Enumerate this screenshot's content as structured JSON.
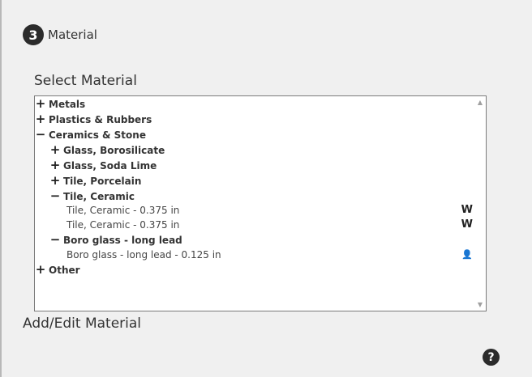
{
  "step": {
    "number": "3",
    "title": "Material"
  },
  "select_label": "Select Material",
  "add_edit_label": "Add/Edit Material",
  "scroll": {
    "up": "▲",
    "down": "▼"
  },
  "help": {
    "glyph": "?"
  },
  "tree": [
    {
      "symbol": "+",
      "label": "Metals"
    },
    {
      "symbol": "+",
      "label": "Plastics & Rubbers"
    },
    {
      "symbol": "−",
      "label": "Ceramics & Stone"
    },
    {
      "symbol": "+",
      "label": "Glass, Borosilicate"
    },
    {
      "symbol": "+",
      "label": "Glass, Soda Lime"
    },
    {
      "symbol": "+",
      "label": "Tile, Porcelain"
    },
    {
      "symbol": "−",
      "label": "Tile, Ceramic"
    },
    {
      "label": "Tile, Ceramic - 0.375 in",
      "icon": "W",
      "icon_name": "w-logo-icon"
    },
    {
      "label": "Tile, Ceramic - 0.375 in",
      "icon": "W",
      "icon_name": "w-logo-icon"
    },
    {
      "symbol": "−",
      "label": "Boro glass - long lead"
    },
    {
      "label": "Boro glass - long lead - 0.125 in",
      "icon": "👤",
      "icon_name": "user-icon"
    },
    {
      "symbol": "+",
      "label": "Other"
    }
  ]
}
